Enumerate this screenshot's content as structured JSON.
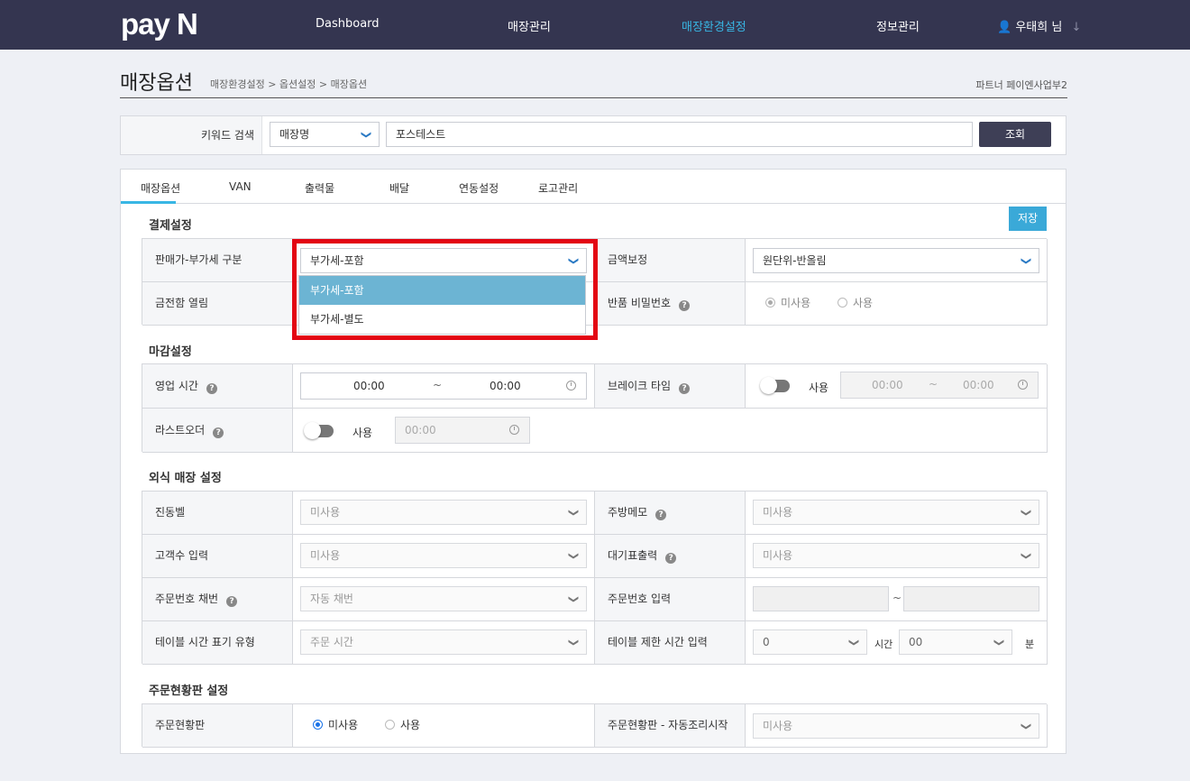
{
  "nav": {
    "logo": "pay N",
    "items": [
      "Dashboard",
      "매장관리",
      "매장환경설정",
      "정보관리"
    ],
    "active": "매장환경설정",
    "user": "우태희 님"
  },
  "header": {
    "title": "매장옵션",
    "breadcrumb": "매장환경설정 > 옵션설정 > 매장옵션",
    "partner": "파트너 페이엔사업부2"
  },
  "search": {
    "label": "키워드 검색",
    "type_value": "매장명",
    "keyword_value": "포스테스트",
    "button": "조회"
  },
  "tabs": [
    "매장옵션",
    "VAN",
    "출력물",
    "배달",
    "연동설정",
    "로고관리"
  ],
  "active_tab": "매장옵션",
  "payment": {
    "title": "결제설정",
    "save": "저장",
    "vat_label": "판매가-부가세 구분",
    "vat_value": "부가세-포함",
    "vat_options": [
      "부가세-포함",
      "부가세-별도"
    ],
    "amount_label": "금액보정",
    "amount_value": "원단위-반올림",
    "drawer_label": "금전함 열림",
    "return_pw_label": "반품 비밀번호",
    "radio_unused": "미사용",
    "radio_used": "사용"
  },
  "closing": {
    "title": "마감설정",
    "hours_label": "영업 시간",
    "hours_start": "00:00",
    "hours_sep": "~",
    "hours_end": "00:00",
    "break_label": "브레이크 타임",
    "break_toggle": "사용",
    "break_start": "00:00",
    "break_end": "00:00",
    "lastorder_label": "라스트오더",
    "lastorder_toggle": "사용",
    "lastorder_time": "00:00"
  },
  "dining": {
    "title": "외식 매장 설정",
    "bell_label": "진동벨",
    "bell_value": "미사용",
    "kitchen_label": "주방메모",
    "kitchen_value": "미사용",
    "guests_label": "고객수 입력",
    "guests_value": "미사용",
    "waiting_label": "대기표출력",
    "waiting_value": "미사용",
    "ordernum_label": "주문번호 채번",
    "ordernum_value": "자동 채번",
    "ordernum_input_label": "주문번호 입력",
    "ordernum_sep": "~",
    "tabletime_label": "테이블 시간 표기 유형",
    "tabletime_value": "주문 시간",
    "tablelimit_label": "테이블 제한 시간 입력",
    "tablelimit_hours": "0",
    "hours_unit": "시간",
    "tablelimit_minutes": "00",
    "minutes_unit": "분"
  },
  "status": {
    "title": "주문현황판 설정",
    "board_label": "주문현황판",
    "radio_unused": "미사용",
    "radio_used": "사용",
    "auto_label": "주문현황판 - 자동조리시작",
    "auto_value": "미사용"
  },
  "colors": {
    "nav_bg": "#343550",
    "accent": "#38b6e4",
    "highlight": "#e30613",
    "dropdown_selected": "#6cb4d3"
  }
}
